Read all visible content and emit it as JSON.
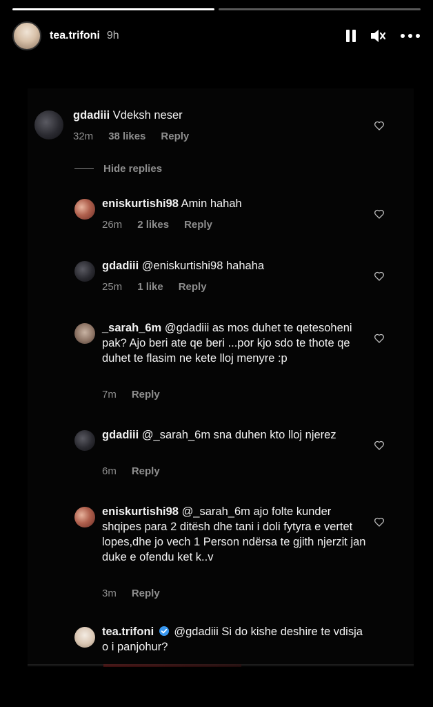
{
  "story": {
    "username": "tea.trifoni",
    "time_ago": "9h",
    "progress": [
      1.0,
      0.0
    ],
    "icons": [
      "pause-icon",
      "mute-icon",
      "more-icon"
    ]
  },
  "thread": {
    "hide_replies_label": "Hide replies",
    "reply_label": "Reply",
    "comments": [
      {
        "username": "gdadiii",
        "text": "Vdeksh neser",
        "time": "32m",
        "likes": "38 likes",
        "avatar": "gdadiii"
      },
      {
        "username": "eniskurtishi98",
        "text": "Amin hahah",
        "time": "26m",
        "likes": "2 likes",
        "avatar": "enis"
      },
      {
        "username": "gdadiii",
        "text": "@eniskurtishi98 hahaha",
        "time": "25m",
        "likes": "1 like",
        "avatar": "gdadiii"
      },
      {
        "username": "_sarah_6m",
        "text": "@gdadiii as mos duhet te qetesoheni pak? Ajo beri ate qe beri ...por kjo sdo te thote qe duhet te flasim ne kete lloj menyre :p",
        "time": "7m",
        "likes": "",
        "avatar": "sarah"
      },
      {
        "username": "gdadiii",
        "text": "@_sarah_6m  sna duhen kto lloj njerez",
        "time": "6m",
        "likes": "",
        "avatar": "gdadiii"
      },
      {
        "username": "eniskurtishi98",
        "text": "@_sarah_6m ajo folte kunder shqipes para 2 ditësh dhe tani i doli fytyra e vertet lopes,dhe jo vech 1 Person ndërsa te gjith njerzit jan duke e ofendu ket k..v",
        "time": "3m",
        "likes": "",
        "avatar": "enis"
      },
      {
        "username": "tea.trifoni",
        "verified": true,
        "text": "@gdadiii Si do kishe deshire te vdisja o i panjohur?",
        "time": "",
        "likes": "",
        "avatar": "tea"
      }
    ]
  },
  "colors": {
    "background": "#000000",
    "text": "#f2f2f2",
    "muted": "#8e8e8e",
    "verified": "#3897f0"
  }
}
